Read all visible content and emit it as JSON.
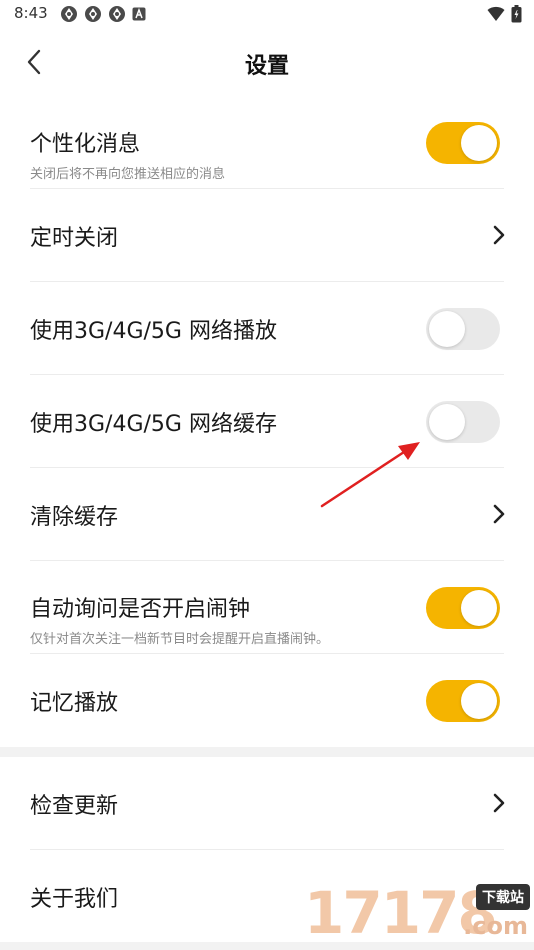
{
  "status_bar": {
    "time": "8:43",
    "left_icons": [
      "app-notification-icon",
      "app-notification-icon",
      "app-notification-icon",
      "font-a-icon"
    ],
    "right_icons": [
      "wifi-icon",
      "battery-icon"
    ]
  },
  "header": {
    "title": "设置",
    "back_icon": "chevron-left-icon"
  },
  "colors": {
    "toggle_on": "#f5b400",
    "toggle_off": "#e9e9e9",
    "arrow": "#e02020"
  },
  "settings": [
    {
      "id": "personalized",
      "title": "个性化消息",
      "subtitle": "关闭后将不再向您推送相应的消息",
      "control": "toggle",
      "on": true
    },
    {
      "id": "timer_off",
      "title": "定时关闭",
      "control": "chevron"
    },
    {
      "id": "mobile_play",
      "title": "使用3G/4G/5G 网络播放",
      "control": "toggle",
      "on": false
    },
    {
      "id": "mobile_cache",
      "title": "使用3G/4G/5G 网络缓存",
      "control": "toggle",
      "on": false
    },
    {
      "id": "clear_cache",
      "title": "清除缓存",
      "control": "chevron"
    },
    {
      "id": "alarm_prompt",
      "title": "自动询问是否开启闹钟",
      "subtitle": "仅针对首次关注一档新节目时会提醒开启直播闹钟。",
      "control": "toggle",
      "on": true
    },
    {
      "id": "resume_play",
      "title": "记忆播放",
      "control": "toggle",
      "on": true
    }
  ],
  "settings_bottom": [
    {
      "id": "check_update",
      "title": "检查更新",
      "control": "chevron"
    },
    {
      "id": "about_us",
      "title": "关于我们",
      "control": "chevron"
    }
  ],
  "watermark": {
    "digits": "17178",
    "badge": "下载站",
    "domain": ".com"
  }
}
